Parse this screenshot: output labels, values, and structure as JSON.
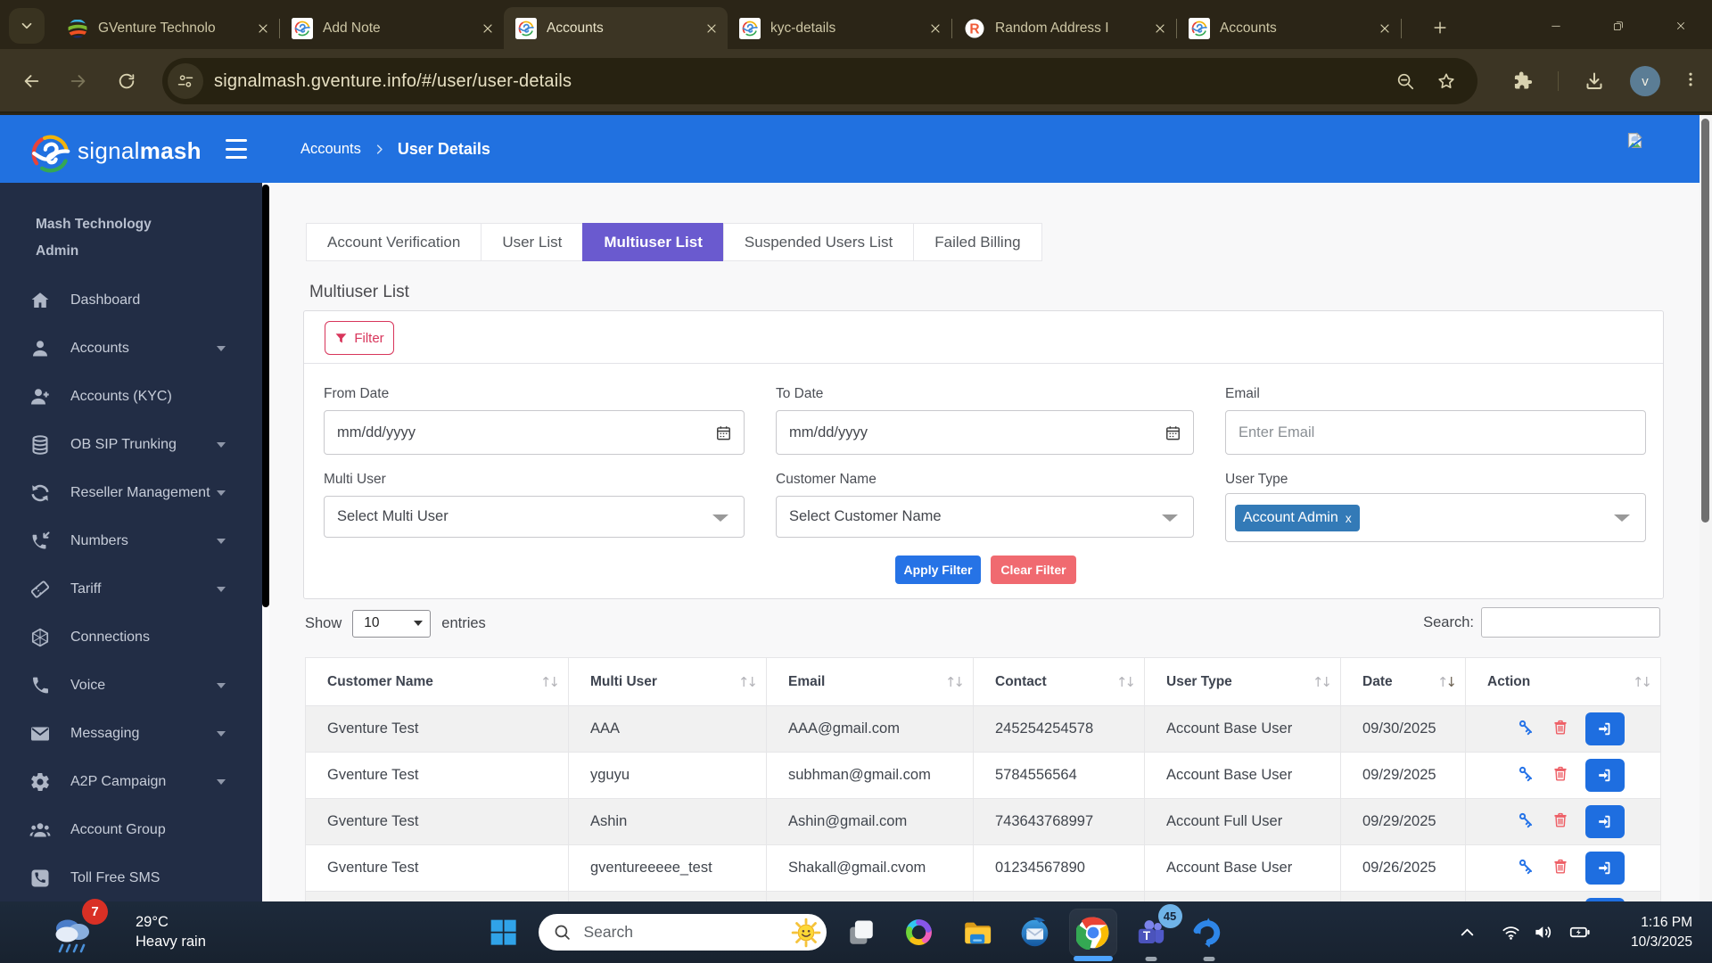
{
  "browser": {
    "tabs": [
      {
        "title": "GVenture Technolo",
        "favicon": "gventure",
        "active": false
      },
      {
        "title": "Add Note",
        "favicon": "signalmash",
        "active": false
      },
      {
        "title": "Accounts",
        "favicon": "signalmash",
        "active": true
      },
      {
        "title": "kyc-details",
        "favicon": "signalmash",
        "active": false
      },
      {
        "title": "Random Address I",
        "favicon": "randomaddr",
        "active": false
      },
      {
        "title": "Accounts",
        "favicon": "signalmash",
        "active": false
      }
    ],
    "url": "signalmash.gventure.info/#/user/user-details",
    "avatar_initial": "v"
  },
  "app": {
    "brand": {
      "light": "signal",
      "bold": "mash"
    },
    "breadcrumb": {
      "parent": "Accounts",
      "current": "User Details"
    },
    "sidebar": {
      "org_line1": "Mash Technology",
      "org_line2": "Admin",
      "items": [
        {
          "label": "Dashboard",
          "icon": "home",
          "caret": false
        },
        {
          "label": "Accounts",
          "icon": "user",
          "caret": true
        },
        {
          "label": "Accounts (KYC)",
          "icon": "user-plus",
          "caret": false
        },
        {
          "label": "OB SIP Trunking",
          "icon": "database",
          "caret": true
        },
        {
          "label": "Reseller Management",
          "icon": "sync",
          "caret": true
        },
        {
          "label": "Numbers",
          "icon": "phone-incoming",
          "caret": true
        },
        {
          "label": "Tariff",
          "icon": "ticket",
          "caret": true
        },
        {
          "label": "Connections",
          "icon": "hexagon",
          "caret": false
        },
        {
          "label": "Voice",
          "icon": "phone",
          "caret": true
        },
        {
          "label": "Messaging",
          "icon": "envelope",
          "caret": true
        },
        {
          "label": "A2P Campaign",
          "icon": "gear",
          "caret": true
        },
        {
          "label": "Account Group",
          "icon": "users",
          "caret": false
        },
        {
          "label": "Toll Free SMS",
          "icon": "phone-square",
          "caret": false
        }
      ]
    },
    "tabs": [
      {
        "label": "Account Verification",
        "active": false
      },
      {
        "label": "User List",
        "active": false
      },
      {
        "label": "Multiuser List",
        "active": true
      },
      {
        "label": "Suspended Users List",
        "active": false
      },
      {
        "label": "Failed Billing",
        "active": false
      }
    ],
    "page_title": "Multiuser List",
    "filter": {
      "button_label": "Filter",
      "from_date": {
        "label": "From Date",
        "placeholder": "mm/dd/yyyy"
      },
      "to_date": {
        "label": "To Date",
        "placeholder": "mm/dd/yyyy"
      },
      "email": {
        "label": "Email",
        "placeholder": "Enter Email"
      },
      "multi_user": {
        "label": "Multi User",
        "value": "Select Multi User"
      },
      "customer_name": {
        "label": "Customer Name",
        "value": "Select Customer Name"
      },
      "user_type": {
        "label": "User Type",
        "tag": "Account Admin",
        "tag_remove": "x"
      },
      "apply_label": "Apply Filter",
      "clear_label": "Clear Filter"
    },
    "list_controls": {
      "show": "Show",
      "page_size": "10",
      "entries": "entries",
      "search_label": "Search:",
      "search_value": ""
    },
    "table": {
      "columns": [
        "Customer Name",
        "Multi User",
        "Email",
        "Contact",
        "User Type",
        "Date",
        "Action"
      ],
      "sorted_column": "Date",
      "rows": [
        {
          "customer": "Gventure Test",
          "multi_user": "AAA",
          "email": "AAA@gmail.com",
          "contact": "245254254578",
          "user_type": "Account Base User",
          "date": "09/30/2025"
        },
        {
          "customer": "Gventure Test",
          "multi_user": "yguyu",
          "email": "subhman@gmail.com",
          "contact": "5784556564",
          "user_type": "Account Base User",
          "date": "09/29/2025"
        },
        {
          "customer": "Gventure Test",
          "multi_user": "Ashin",
          "email": "Ashin@gmail.com",
          "contact": "743643768997",
          "user_type": "Account Full User",
          "date": "09/29/2025"
        },
        {
          "customer": "Gventure Test",
          "multi_user": "gventureeeee_test",
          "email": "Shakall@gmail.cvom",
          "contact": "01234567890",
          "user_type": "Account Base User",
          "date": "09/26/2025"
        },
        {
          "customer": "",
          "multi_user": "",
          "email": "",
          "contact": "",
          "user_type": "",
          "date": ""
        }
      ]
    },
    "colors": {
      "header_blue": "#2171e0",
      "sidebar_navy": "#222d45",
      "active_tab_purple": "#6a5acf",
      "accent_blue": "#2673e6",
      "danger_red": "#d8355b",
      "tag_blue": "#337ab7"
    }
  },
  "taskbar": {
    "weather": {
      "badge": "7",
      "temp": "29°C",
      "condition": "Heavy rain"
    },
    "search_placeholder": "Search",
    "teams_badge": "45",
    "clock": {
      "time": "1:16 PM",
      "date": "10/3/2025"
    }
  }
}
